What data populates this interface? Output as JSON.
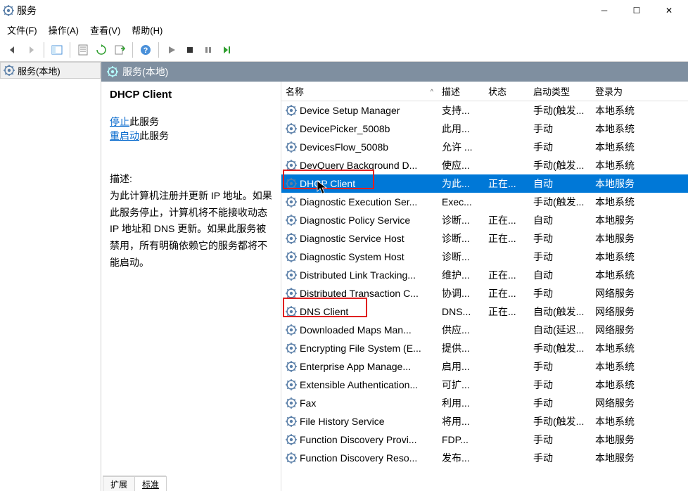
{
  "window": {
    "title": "服务"
  },
  "menu": {
    "file": "文件(F)",
    "action": "操作(A)",
    "view": "查看(V)",
    "help": "帮助(H)"
  },
  "tree": {
    "root": "服务(本地)"
  },
  "pane_header": "服务(本地)",
  "detail": {
    "selected_service": "DHCP Client",
    "stop_link": "停止",
    "stop_suffix": "此服务",
    "restart_link": "重启动",
    "restart_suffix": "此服务",
    "desc_label": "描述:",
    "desc_text": "为此计算机注册并更新 IP 地址。如果此服务停止，计算机将不能接收动态 IP 地址和 DNS 更新。如果此服务被禁用，所有明确依赖它的服务都将不能启动。"
  },
  "columns": {
    "name": "名称",
    "desc": "描述",
    "state": "状态",
    "start": "启动类型",
    "logon": "登录为"
  },
  "services": [
    {
      "name": "Device Setup Manager",
      "desc": "支持...",
      "state": "",
      "start": "手动(触发...",
      "logon": "本地系统"
    },
    {
      "name": "DevicePicker_5008b",
      "desc": "此用...",
      "state": "",
      "start": "手动",
      "logon": "本地系统"
    },
    {
      "name": "DevicesFlow_5008b",
      "desc": "允许 ...",
      "state": "",
      "start": "手动",
      "logon": "本地系统"
    },
    {
      "name": "DevQuery Background D...",
      "desc": "使应...",
      "state": "",
      "start": "手动(触发...",
      "logon": "本地系统"
    },
    {
      "name": "DHCP Client",
      "desc": "为此...",
      "state": "正在...",
      "start": "自动",
      "logon": "本地服务",
      "selected": true
    },
    {
      "name": "Diagnostic Execution Ser...",
      "desc": "Exec...",
      "state": "",
      "start": "手动(触发...",
      "logon": "本地系统"
    },
    {
      "name": "Diagnostic Policy Service",
      "desc": "诊断...",
      "state": "正在...",
      "start": "自动",
      "logon": "本地服务"
    },
    {
      "name": "Diagnostic Service Host",
      "desc": "诊断...",
      "state": "正在...",
      "start": "手动",
      "logon": "本地服务"
    },
    {
      "name": "Diagnostic System Host",
      "desc": "诊断...",
      "state": "",
      "start": "手动",
      "logon": "本地系统"
    },
    {
      "name": "Distributed Link Tracking...",
      "desc": "维护...",
      "state": "正在...",
      "start": "自动",
      "logon": "本地系统"
    },
    {
      "name": "Distributed Transaction C...",
      "desc": "协调...",
      "state": "正在...",
      "start": "手动",
      "logon": "网络服务"
    },
    {
      "name": "DNS Client",
      "desc": "DNS...",
      "state": "正在...",
      "start": "自动(触发...",
      "logon": "网络服务"
    },
    {
      "name": "Downloaded Maps Man...",
      "desc": "供应...",
      "state": "",
      "start": "自动(延迟...",
      "logon": "网络服务"
    },
    {
      "name": "Encrypting File System (E...",
      "desc": "提供...",
      "state": "",
      "start": "手动(触发...",
      "logon": "本地系统"
    },
    {
      "name": "Enterprise App Manage...",
      "desc": "启用...",
      "state": "",
      "start": "手动",
      "logon": "本地系统"
    },
    {
      "name": "Extensible Authentication...",
      "desc": "可扩...",
      "state": "",
      "start": "手动",
      "logon": "本地系统"
    },
    {
      "name": "Fax",
      "desc": "利用...",
      "state": "",
      "start": "手动",
      "logon": "网络服务"
    },
    {
      "name": "File History Service",
      "desc": "将用...",
      "state": "",
      "start": "手动(触发...",
      "logon": "本地系统"
    },
    {
      "name": "Function Discovery Provi...",
      "desc": "FDP...",
      "state": "",
      "start": "手动",
      "logon": "本地服务"
    },
    {
      "name": "Function Discovery Reso...",
      "desc": "发布...",
      "state": "",
      "start": "手动",
      "logon": "本地服务"
    }
  ],
  "tabs": {
    "extended": "扩展",
    "standard": "标准"
  }
}
